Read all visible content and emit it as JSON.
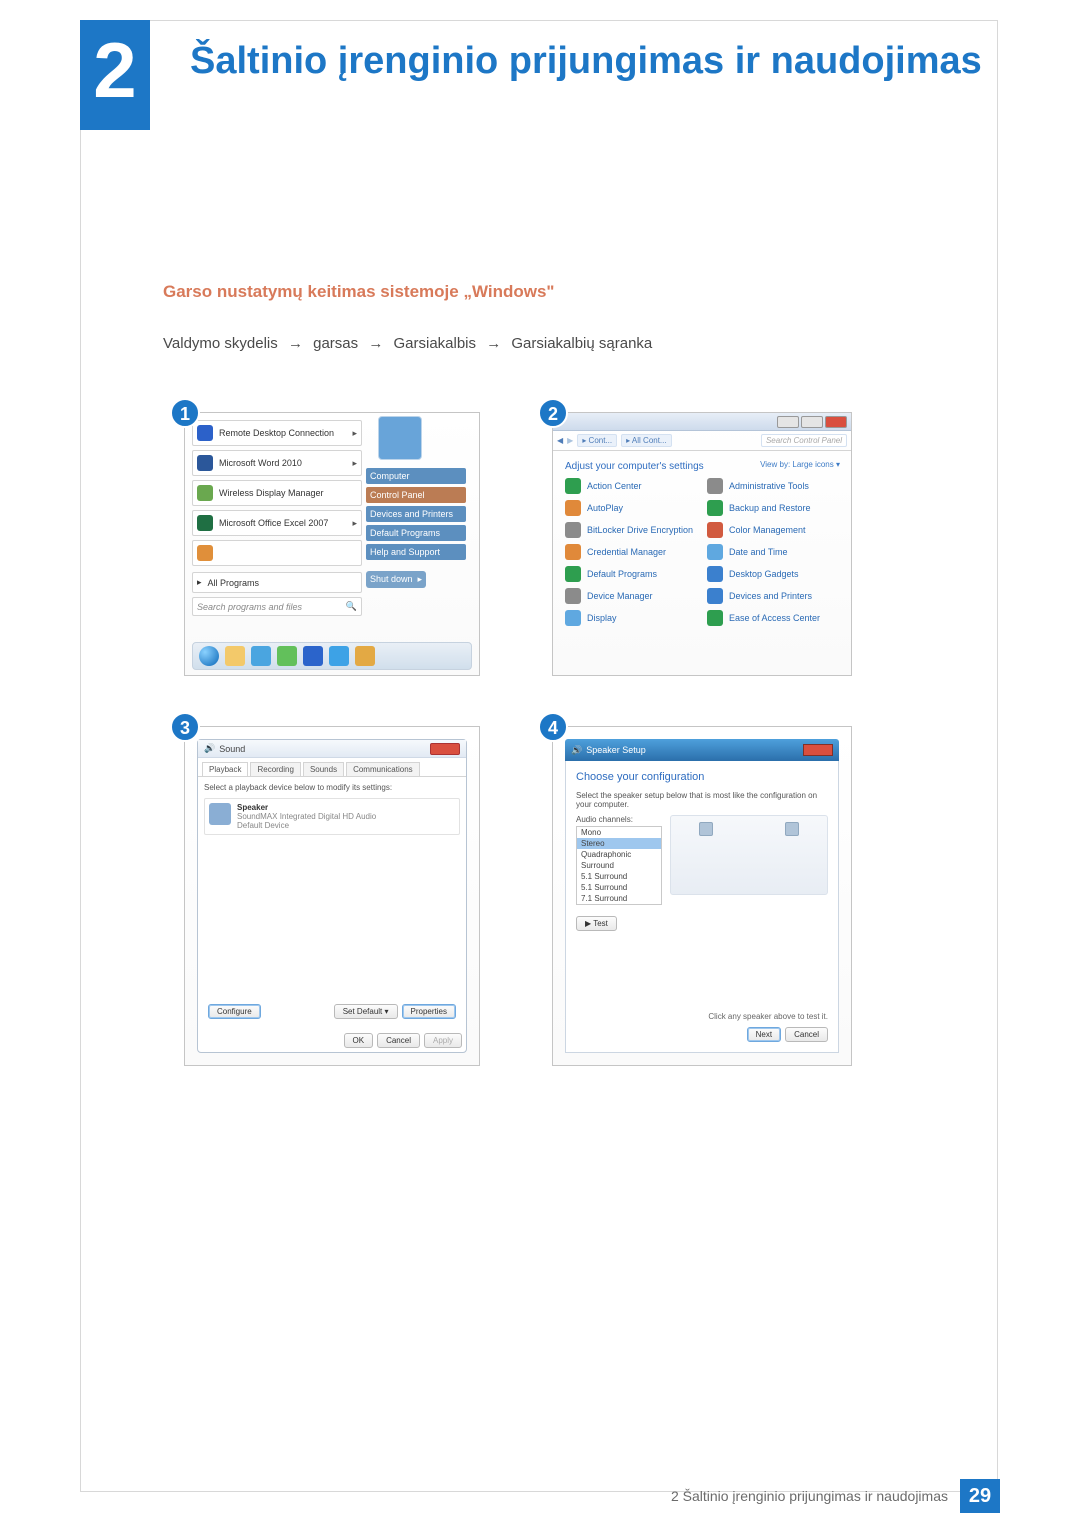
{
  "chapter": {
    "number": "2",
    "title": "Šaltinio įrenginio prijungimas ir naudojimas"
  },
  "section": {
    "title": "Garso nustatymų keitimas sistemoje „Windows\""
  },
  "path": {
    "p1": "Valdymo skydelis",
    "p2": "garsas",
    "p3": "Garsiakalbis",
    "p4": "Garsiakalbių sąranka"
  },
  "steps": {
    "s1": {
      "num": "1",
      "items": [
        "Remote Desktop Connection",
        "Microsoft Word 2010",
        "Wireless Display Manager",
        "Microsoft Office Excel 2007"
      ],
      "all": "All Programs",
      "search_ph": "Search programs and files",
      "right": [
        "Computer",
        "Control Panel",
        "Devices and Printers",
        "Default Programs",
        "Help and Support"
      ],
      "shutdown": "Shut down"
    },
    "s2": {
      "num": "2",
      "crumb1": "▸ Cont...",
      "crumb2": "▸ All Cont...",
      "search_ph": "Search Control Panel",
      "heading": "Adjust your computer's settings",
      "view": "View by:   Large icons ▾",
      "items": [
        "Action Center",
        "Administrative Tools",
        "AutoPlay",
        "Backup and Restore",
        "BitLocker Drive Encryption",
        "Color Management",
        "Credential Manager",
        "Date and Time",
        "Default Programs",
        "Desktop Gadgets",
        "Device Manager",
        "Devices and Printers",
        "Display",
        "Ease of Access Center"
      ]
    },
    "s3": {
      "num": "3",
      "title": "Sound",
      "tabs": [
        "Playback",
        "Recording",
        "Sounds",
        "Communications"
      ],
      "hint": "Select a playback device below to modify its settings:",
      "spk_name": "Speaker",
      "spk_desc": "SoundMAX Integrated Digital HD Audio",
      "spk_state": "Default Device",
      "configure": "Configure",
      "setdefault": "Set Default ▾",
      "properties": "Properties",
      "ok": "OK",
      "cancel": "Cancel",
      "apply": "Apply"
    },
    "s4": {
      "num": "4",
      "title": "Speaker Setup",
      "heading": "Choose your configuration",
      "sub": "Select the speaker setup below that is most like the configuration on your computer.",
      "ch_label": "Audio channels:",
      "channels": [
        "Mono",
        "Stereo",
        "Quadraphonic",
        "Surround",
        "5.1 Surround",
        "5.1 Surround",
        "7.1 Surround"
      ],
      "test": "▶ Test",
      "hint": "Click any speaker above to test it.",
      "next": "Next",
      "cancel": "Cancel"
    }
  },
  "footer": {
    "text": "2 Šaltinio įrenginio prijungimas ir naudojimas",
    "page": "29"
  }
}
